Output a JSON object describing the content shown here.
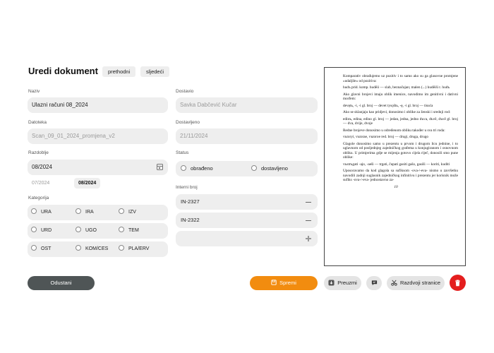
{
  "header": {
    "title": "Uredi dokument",
    "prev_label": "prethodni",
    "next_label": "sljedeći"
  },
  "form": {
    "naziv": {
      "label": "Naziv",
      "value": "Ulazni računi 08_2024"
    },
    "datoteka": {
      "label": "Datoteka",
      "value": "Scan_09_01_2024_promjena_v2"
    },
    "razdoblje": {
      "label": "Razdoblje",
      "value": "08/2024",
      "months": [
        "07/2024",
        "08/2024"
      ],
      "selected_month": "08/2024"
    },
    "kategorija": {
      "label": "Kategorija",
      "rows": [
        [
          "URA",
          "IRA",
          "IZV"
        ],
        [
          "URD",
          "UGO",
          "TEM"
        ],
        [
          "OST",
          "KOM/CES",
          "PLA/ERV"
        ]
      ]
    },
    "dostavio": {
      "label": "Dostavio",
      "placeholder": "Savka Dabčević Kučar"
    },
    "dostavljeno": {
      "label": "Dostavljeno",
      "placeholder": "21/11/2024"
    },
    "status": {
      "label": "Status",
      "options": [
        "obrađeno",
        "dostavljeno"
      ]
    },
    "interni_broj": {
      "label": "Interni broj",
      "items": [
        "IN-2327",
        "IN-2322"
      ]
    }
  },
  "actions": {
    "cancel_label": "Odustani",
    "save_label": "Spremi",
    "download_label": "Preuzmi",
    "split_label": "Razdvoji stranice"
  },
  "colors": {
    "save": "#f28c0f",
    "cancel": "#4f5556",
    "delete": "#e41e1e",
    "field_bg": "#eeeeee"
  },
  "icons": {
    "calendar": "calendar-icon",
    "save": "save-icon",
    "download": "download-icon",
    "comment": "comment-icon",
    "split": "scissors-icon",
    "delete": "trash-icon",
    "remove": "minus-icon",
    "add": "plus-icon"
  },
  "preview": {
    "paragraphs": [
      "Komparativ obrađujemo uz pozitiv i to samo ako su ga glasovne promjene »udaljile« od pozitiva:",
      "hudъ prid. komp. hudĕii — slab, beznačajan; malen (...) hudĕiši r. hudъ",
      "Ako glavni brojevi imaju oblik imenice, navodimo im genitivni i dativni morfem:",
      "devętь, -i, -i gl. broj — devet tysǫštь, -ę, -i gl. broj — tisuća",
      "Ako se sklanjaju kao pridjevi, donosimo i oblike za ženski i srednji rod:",
      "edinъ, edina, edino gl. broj — jedan, jedna, jedno dъva, dъvĕ, dъvĕ gl. broj — dva, dvije, dvoje",
      "Redne brojeve donosimo u određenom obliku također u sva tri roda:",
      "vъtoryi, vъtorae, vъtoroe red. broj — drugi, druga, drugo",
      "Glagole donosimo samo u prezentu u prvom i drugom licu jednine, i to uglavnom od posljednjeg zajedničkog grafema u konjugiranom i osnovnom obliku. U primjerima gdje se mijenja gotovo cijela riječ, donosili smo pune oblike:",
      "vъstrъgati -ajo, -aeši — trgati, čupati gasiti gašo, gasiši — koriti, kuditi",
      "Uposoravamo da kod glagola sa sufiksom -ova-/-eva- nismo u završetku navodili zadnji suglasnik zajedničkog infinitivu i prezentu jer korisnik može sufiks -ova-/-eva- jednostavno za-",
      "10"
    ]
  }
}
